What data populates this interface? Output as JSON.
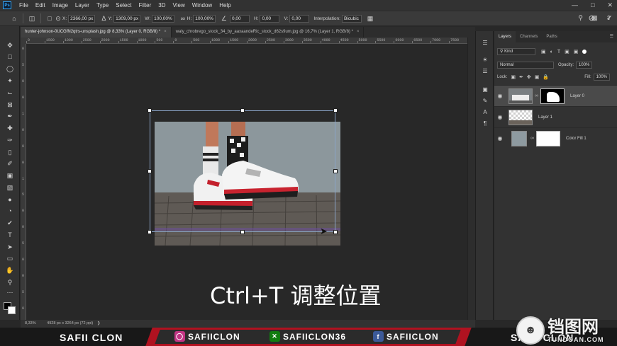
{
  "menubar": {
    "logo": "Ps",
    "items": [
      "File",
      "Edit",
      "Image",
      "Layer",
      "Type",
      "Select",
      "Filter",
      "3D",
      "View",
      "Window",
      "Help"
    ]
  },
  "options": {
    "x_label": "X:",
    "x_value": "2366,00 px",
    "y_label": "Y:",
    "y_value": "1309,00 px",
    "w_label": "W:",
    "w_value": "100,00%",
    "h_label": "H:",
    "h_value": "100,00%",
    "angle_value": "0,00",
    "hskew_label": "H:",
    "hskew_value": "0,00",
    "vskew_label": "V:",
    "vskew_value": "0,00",
    "interpolation_label": "Interpolation:",
    "interpolation_value": "Bicubic"
  },
  "tabs": [
    {
      "label": "hunter-johnson-0UCGfN2qtrs-unsplash.jpg @ 8,33% (Layer 0, RGB/8) *"
    },
    {
      "label": "waly_chrobrego_stock_34_by_aaxaandeRic_stock_d62s9um.jpg @ 16,7% (Layer 1, RGB/8) *"
    }
  ],
  "ruler": {
    "top_labels": [
      "0",
      "1500",
      "1000",
      "2500",
      "2000",
      "1500",
      "1000",
      "500",
      "0",
      "500",
      "1000",
      "1500",
      "2000",
      "2500",
      "3000",
      "3500",
      "4000",
      "4500",
      "5000",
      "5500",
      "6000",
      "6500",
      "7000",
      "7500"
    ],
    "left_labels": [
      "0",
      "5",
      "0",
      "0",
      "1",
      "0",
      "0",
      "0",
      "1",
      "5",
      "0",
      "0",
      "5",
      "0",
      "0",
      "5",
      "0"
    ]
  },
  "canvas": {
    "caption": "Ctrl+T 调整位置"
  },
  "status": {
    "zoom": "8,33%",
    "doc_info": "4928 px x 3264 px (72 ppi)"
  },
  "layers_panel": {
    "tabs": [
      "Layers",
      "Channels",
      "Paths"
    ],
    "kind_label": "Kind",
    "blend_mode": "Normal",
    "opacity_label": "Opacity:",
    "opacity_value": "100%",
    "lock_label": "Lock:",
    "fill_label": "Fill:",
    "fill_value": "100%",
    "layers": [
      {
        "name": "Layer 0",
        "selected": true
      },
      {
        "name": "Layer 1",
        "selected": false
      },
      {
        "name": "Color Fill 1",
        "selected": false
      }
    ]
  },
  "banner": {
    "left_text": "SAFII CLON",
    "instagram": "SAFIICLON",
    "xbox": "SAFIICLON36",
    "facebook": "SAFIICLON",
    "right_text": "SAFII CLON"
  },
  "watermark": {
    "big": "铛图网",
    "small": "TUNDOAN.COM"
  },
  "colors": {
    "app_bg": "#282828",
    "panel_bg": "#323232",
    "banner_red": "#b01220",
    "selection_blue": "#8aa3c7",
    "ps_blue": "#31a8ff"
  }
}
